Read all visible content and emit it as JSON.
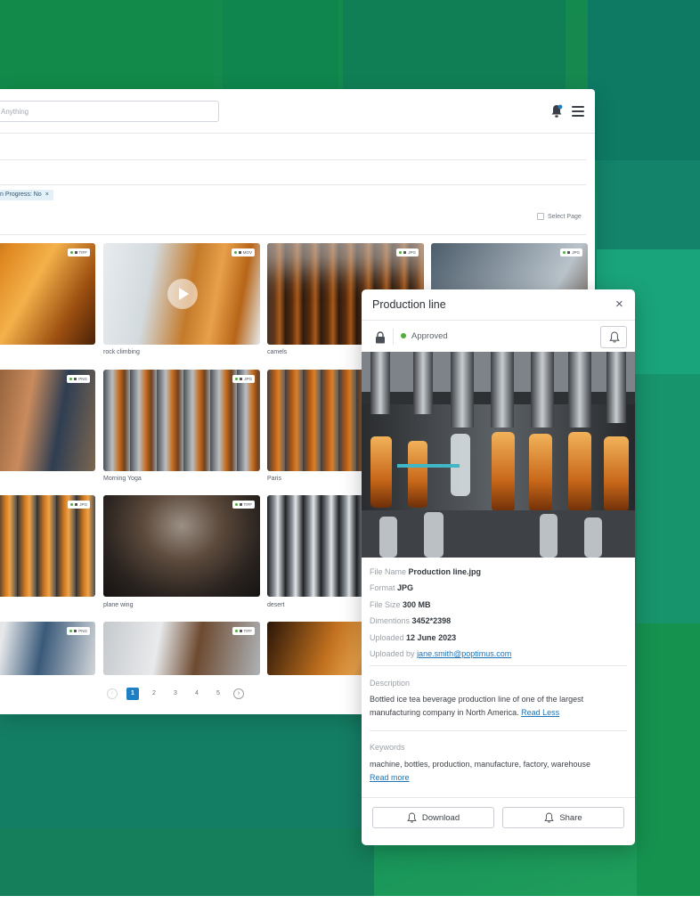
{
  "search": {
    "placeholder": "Anything"
  },
  "filters": {
    "chip_label": "n Progress: No",
    "chip_remove": "×"
  },
  "select_page_label": "Select Page",
  "grid": [
    {
      "label": "",
      "badge": "TIFF"
    },
    {
      "label": "rock climbing",
      "badge": "MOV"
    },
    {
      "label": "camels",
      "badge": "JPG"
    },
    {
      "label": "",
      "badge": "JPG"
    },
    {
      "label": "",
      "badge": "PNG"
    },
    {
      "label": "Morning Yoga",
      "badge": "JPG"
    },
    {
      "label": "Paris",
      "badge": ""
    },
    {
      "label": "",
      "badge": "JPG"
    },
    {
      "label": "plane wing",
      "badge": "TIFF"
    },
    {
      "label": "desert",
      "badge": ""
    },
    {
      "label": "",
      "badge": "PNG"
    },
    {
      "label": "",
      "badge": "TIFF"
    },
    {
      "label": "",
      "badge": ""
    }
  ],
  "pagination": {
    "pages": [
      "1",
      "2",
      "3",
      "4",
      "5"
    ],
    "active": "1"
  },
  "panel": {
    "title": "Production line",
    "close": "×",
    "status": "Approved",
    "status_color": "#4caf3a",
    "fields": {
      "file_name_label": "File Name",
      "file_name": "Production line.jpg",
      "format_label": "Format",
      "format": "JPG",
      "file_size_label": "File Size",
      "file_size": "300 MB",
      "dimentions_label": "Dimentions",
      "dimentions": "3452*2398",
      "uploaded_label": "Uploaded",
      "uploaded": "12 June 2023",
      "uploaded_by_label": "Uploaded by",
      "uploaded_by": "jane.smith@poptimus.com"
    },
    "description": {
      "title": "Description",
      "text": "Bottled ice tea beverage production line of one of the largest manufacturing company in North America.",
      "toggle": "Read Less"
    },
    "keywords": {
      "title": "Keywords",
      "text": "machine, bottles, production, manufacture, factory, warehouse",
      "toggle": "Read more"
    },
    "buttons": {
      "download": "Download",
      "share": "Share"
    }
  },
  "icons": {
    "bell": "bell-icon",
    "menu": "hamburger-menu-icon",
    "lock": "lock-icon",
    "close": "close-icon",
    "play": "play-icon"
  },
  "colors": {
    "accent": "#1f7fc4",
    "link": "#1f73b7",
    "approved": "#4caf3a"
  }
}
